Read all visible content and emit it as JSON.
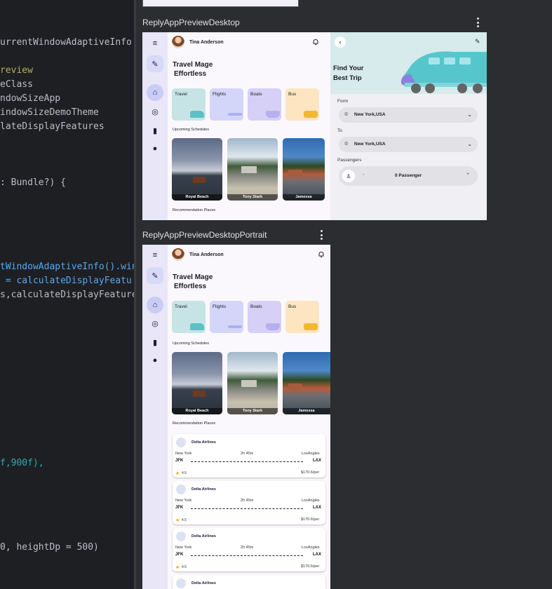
{
  "editor": {
    "lines": [
      {
        "text": "urrentWindowAdaptiveInfo",
        "cls": "c-def"
      },
      {
        "text": "review",
        "cls": "c-ann"
      },
      {
        "text": "eClass",
        "cls": "c-def"
      },
      {
        "text": "ndowSizeApp",
        "cls": "c-def"
      },
      {
        "text": "indowSizeDemoTheme",
        "cls": "c-def"
      },
      {
        "text": "lateDisplayFeatures",
        "cls": "c-def"
      },
      {
        "text": ": Bundle?) {",
        "cls": "c-def"
      },
      {
        "text": "tWindowAdaptiveInfo().win",
        "cls": "c-call"
      },
      {
        "text": " = calculateDisplayFeatu",
        "cls": "c-call"
      },
      {
        "text": "s,calculateDisplayFeature",
        "cls": "c-def"
      },
      {
        "text": "f,900f),",
        "cls": "c-num"
      },
      {
        "text": "0, heightDp = 500)",
        "cls": "c-num"
      }
    ]
  },
  "previews": [
    {
      "label": "ReplyAppPreviewDesktop"
    },
    {
      "label": "ReplyAppPreviewDesktopPortrait"
    }
  ],
  "app": {
    "user_name": "Tina Anderson",
    "headline_1": "Travel Mage",
    "headline_2": "Effortless",
    "categories": [
      {
        "label": "Travel",
        "color": "#c6e4e6"
      },
      {
        "label": "Flights",
        "color": "#d3d6f8"
      },
      {
        "label": "Boats",
        "color": "#d6d0f6"
      },
      {
        "label": "Bus",
        "color": "#fde5c2"
      }
    ],
    "upcoming_label": "Upcoming Schedules",
    "places": [
      {
        "caption": "Royal Beach"
      },
      {
        "caption": "Tony Stark"
      },
      {
        "caption": "Jamessa"
      }
    ],
    "recommendation_label": "Recommendation Places",
    "flights": [
      {
        "airline": "Delta Airlines",
        "from_city": "New York",
        "to_city": "LosAngles",
        "duration": "2h 45m",
        "from_code": "JFK",
        "to_code": "LAX",
        "rating": "4.5",
        "price": "$170.6/per"
      },
      {
        "airline": "Delta Airlines",
        "from_city": "New York",
        "to_city": "LosAngles",
        "duration": "2h 45m",
        "from_code": "JFK",
        "to_code": "LAX",
        "rating": "4.5",
        "price": "$170.6/per"
      },
      {
        "airline": "Delta Airlines",
        "from_city": "New York",
        "to_city": "LosAngles",
        "duration": "2h 45m",
        "from_code": "JFK",
        "to_code": "LAX",
        "rating": "4.5",
        "price": "$170.6/per"
      },
      {
        "airline": "Delta Airlines"
      }
    ]
  },
  "booking": {
    "title_1": "Find Your",
    "title_2": "Best Trip",
    "from_label": "Form",
    "from_value": "New York,USA",
    "to_label": "To",
    "to_value": "New York,USA",
    "passengers_label": "Passengers",
    "passengers_value": "0 Passenger",
    "minus": "-",
    "plus": "+"
  }
}
